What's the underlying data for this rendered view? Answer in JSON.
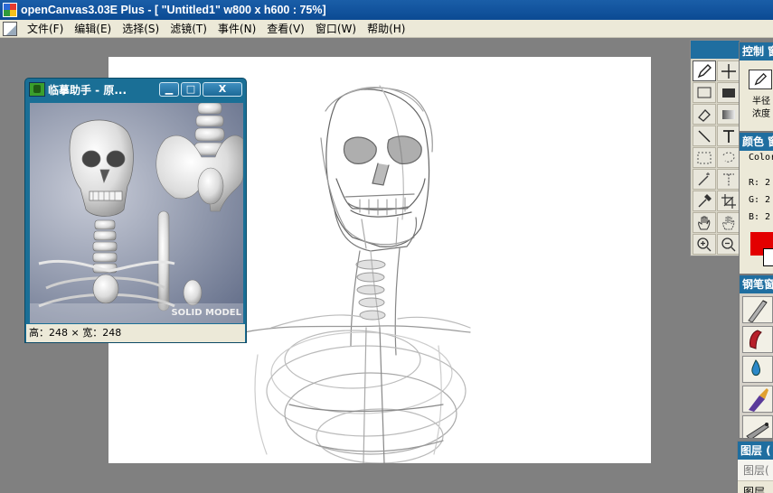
{
  "window": {
    "title": "openCanvas3.03E Plus - [ \"Untitled1\" w800 x h600 : 75%]"
  },
  "menu": {
    "items": [
      "文件(F)",
      "编辑(E)",
      "选择(S)",
      "滤镜(T)",
      "事件(N)",
      "查看(V)",
      "窗口(W)",
      "帮助(H)"
    ]
  },
  "reference_window": {
    "title": "临摹助手 - 原...",
    "minimize": "▁",
    "maximize": "□",
    "close": "X",
    "image_brand": "SOLID MODEL",
    "status": "高：248 × 宽：248"
  },
  "panels": {
    "control": {
      "title": "控制 窗",
      "label1": "半径",
      "label2": "浓度"
    },
    "color": {
      "title": "颜色 窗",
      "mode": "Color",
      "r": "R: 2",
      "g": "G: 2",
      "b": "B: 2",
      "accent": "#e30000"
    },
    "brush": {
      "title": "钢笔窗"
    },
    "layer": {
      "title": "图层 (",
      "row1": "图层(",
      "row2": "图层"
    }
  },
  "tools": {
    "items": [
      "pen-icon",
      "move-icon",
      "rect-select-icon",
      "fill-black-icon",
      "eraser-icon",
      "gradient-icon",
      "line-icon",
      "text-icon",
      "lasso-rect-icon",
      "lasso-free-icon",
      "wand-icon",
      "text-select-icon",
      "dropper-icon",
      "crop-icon",
      "hand-icon",
      "rotate-hand-icon",
      "zoom-in-icon",
      "zoom-out-icon"
    ]
  }
}
